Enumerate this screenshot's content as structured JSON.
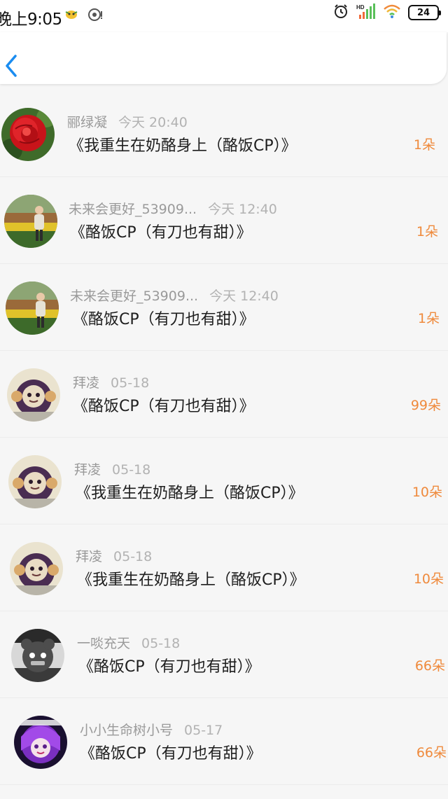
{
  "status_bar": {
    "time": "晚上9:05",
    "battery": "24"
  },
  "nav": {
    "back_icon": "chevron-left-icon",
    "accent": "#1a8cf0"
  },
  "colors": {
    "count": "#ef8a3c",
    "username": "#9a9a9a",
    "title": "#1e1e1e"
  },
  "gifts": [
    {
      "avatar": "red-rose",
      "username": "郦绿凝",
      "time": "今天 20:40",
      "title": "《我重生在奶酪身上（酪饭CP）》",
      "count": "1朵"
    },
    {
      "avatar": "garden-person",
      "username": "未来会更好_53909...",
      "time": "今天 12:40",
      "title": "《酪饭CP（有刀也有甜）》",
      "count": "1朵"
    },
    {
      "avatar": "garden-person",
      "username": "未来会更好_53909...",
      "time": "今天 12:40",
      "title": "《酪饭CP（有刀也有甜）》",
      "count": "1朵"
    },
    {
      "avatar": "cartoon-cat",
      "username": "拜凌",
      "time": "05-18",
      "title": "《酪饭CP（有刀也有甜）》",
      "count": "99朵"
    },
    {
      "avatar": "cartoon-cat",
      "username": "拜凌",
      "time": "05-18",
      "title": "《我重生在奶酪身上（酪饭CP）》",
      "count": "10朵"
    },
    {
      "avatar": "cartoon-cat",
      "username": "拜凌",
      "time": "05-18",
      "title": "《我重生在奶酪身上（酪饭CP）》",
      "count": "10朵"
    },
    {
      "avatar": "dark-bear",
      "username": "一啖充天",
      "time": "05-18",
      "title": "《酪饭CP（有刀也有甜）》",
      "count": "66朵"
    },
    {
      "avatar": "purple-anime",
      "username": "小小生命树小号",
      "time": "05-17",
      "title": "《酪饭CP（有刀也有甜）》",
      "count": "66朵"
    }
  ]
}
